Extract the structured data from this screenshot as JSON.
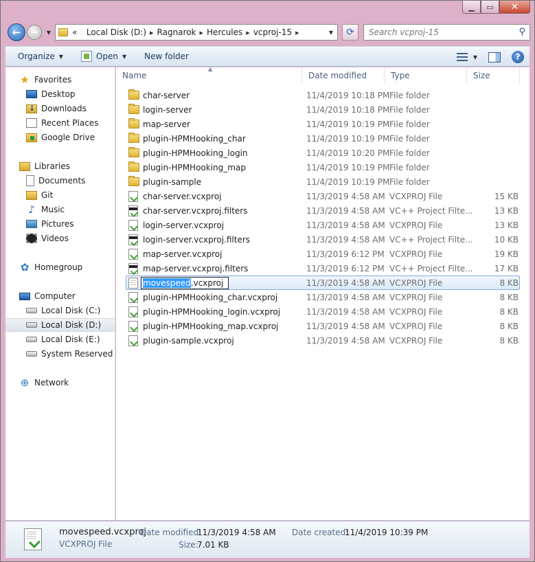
{
  "address": {
    "prefix": "«",
    "crumbs": [
      "Local Disk (D:)",
      "Ragnarok",
      "Hercules",
      "vcproj-15"
    ],
    "search_placeholder": "Search vcproj-15"
  },
  "toolbar": {
    "organize": "Organize",
    "open": "Open",
    "new_folder": "New folder",
    "help": "?"
  },
  "nav": {
    "favorites": "Favorites",
    "favorites_items": [
      "Desktop",
      "Downloads",
      "Recent Places",
      "Google Drive"
    ],
    "libraries": "Libraries",
    "libraries_items": [
      "Documents",
      "Git",
      "Music",
      "Pictures",
      "Videos"
    ],
    "homegroup": "Homegroup",
    "computer": "Computer",
    "computer_items": [
      "Local Disk (C:)",
      "Local Disk (D:)",
      "Local Disk (E:)",
      "System Reserved (H:"
    ],
    "network": "Network"
  },
  "columns": {
    "name": "Name",
    "date": "Date modified",
    "type": "Type",
    "size": "Size"
  },
  "files": [
    {
      "name": "char-server",
      "date": "11/4/2019 10:18 PM",
      "type": "File folder",
      "size": "",
      "icon": "folder"
    },
    {
      "name": "login-server",
      "date": "11/4/2019 10:18 PM",
      "type": "File folder",
      "size": "",
      "icon": "folder"
    },
    {
      "name": "map-server",
      "date": "11/4/2019 10:19 PM",
      "type": "File folder",
      "size": "",
      "icon": "folder"
    },
    {
      "name": "plugin-HPMHooking_char",
      "date": "11/4/2019 10:19 PM",
      "type": "File folder",
      "size": "",
      "icon": "folder"
    },
    {
      "name": "plugin-HPMHooking_login",
      "date": "11/4/2019 10:20 PM",
      "type": "File folder",
      "size": "",
      "icon": "folder"
    },
    {
      "name": "plugin-HPMHooking_map",
      "date": "11/4/2019 10:19 PM",
      "type": "File folder",
      "size": "",
      "icon": "folder"
    },
    {
      "name": "plugin-sample",
      "date": "11/4/2019 10:19 PM",
      "type": "File folder",
      "size": "",
      "icon": "folder"
    },
    {
      "name": "char-server.vcxproj",
      "date": "11/3/2019 4:58 AM",
      "type": "VCXPROJ File",
      "size": "15 KB",
      "icon": "vcxproj"
    },
    {
      "name": "char-server.vcxproj.filters",
      "date": "11/3/2019 4:58 AM",
      "type": "VC++ Project Filte...",
      "size": "13 KB",
      "icon": "filters"
    },
    {
      "name": "login-server.vcxproj",
      "date": "11/3/2019 4:58 AM",
      "type": "VCXPROJ File",
      "size": "13 KB",
      "icon": "vcxproj"
    },
    {
      "name": "login-server.vcxproj.filters",
      "date": "11/3/2019 4:58 AM",
      "type": "VC++ Project Filte...",
      "size": "10 KB",
      "icon": "filters"
    },
    {
      "name": "map-server.vcxproj",
      "date": "11/3/2019 6:12 PM",
      "type": "VCXPROJ File",
      "size": "19 KB",
      "icon": "vcxproj"
    },
    {
      "name": "map-server.vcxproj.filters",
      "date": "11/3/2019 6:12 PM",
      "type": "VC++ Project Filte...",
      "size": "17 KB",
      "icon": "filters"
    },
    {
      "name_selected": "movespeed",
      "name_rest": ".vcxproj",
      "date": "11/3/2019 4:58 AM",
      "type": "VCXPROJ File",
      "size": "8 KB",
      "icon": "doc",
      "renaming": true
    },
    {
      "name": "plugin-HPMHooking_char.vcxproj",
      "date": "11/3/2019 4:58 AM",
      "type": "VCXPROJ File",
      "size": "8 KB",
      "icon": "vcxproj"
    },
    {
      "name": "plugin-HPMHooking_login.vcxproj",
      "date": "11/3/2019 4:58 AM",
      "type": "VCXPROJ File",
      "size": "8 KB",
      "icon": "vcxproj"
    },
    {
      "name": "plugin-HPMHooking_map.vcxproj",
      "date": "11/3/2019 4:58 AM",
      "type": "VCXPROJ File",
      "size": "8 KB",
      "icon": "vcxproj"
    },
    {
      "name": "plugin-sample.vcxproj",
      "date": "11/3/2019 4:58 AM",
      "type": "VCXPROJ File",
      "size": "8 KB",
      "icon": "vcxproj"
    }
  ],
  "details": {
    "name": "movespeed.vcxproj",
    "type": "VCXPROJ File",
    "date_modified_label": "Date modified:",
    "date_modified": "11/3/2019 4:58 AM",
    "date_created_label": "Date created:",
    "date_created": "11/4/2019 10:39 PM",
    "size_label": "Size:",
    "size": "7.01 KB"
  },
  "colors": {
    "frame": "#ddb1c9",
    "selection": "#dceafa",
    "rename_highlight": "#3399ff"
  }
}
